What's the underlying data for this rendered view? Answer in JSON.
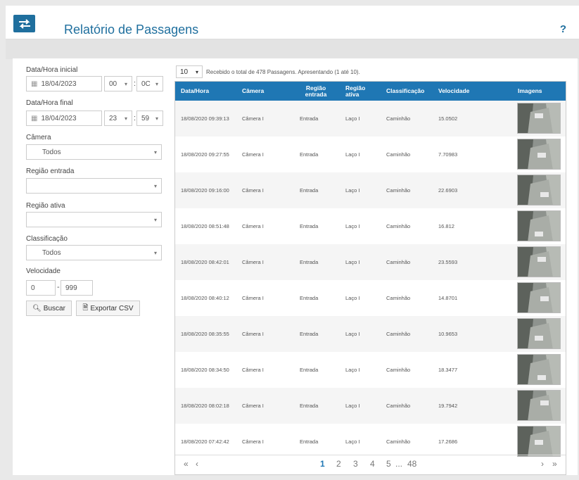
{
  "header": {
    "title": "Relatório de Passagens",
    "help": "?"
  },
  "filters": {
    "start_label": "Data/Hora inicial",
    "start_date": "18/04/2023",
    "start_hour": "00",
    "start_minute": "0C",
    "end_label": "Data/Hora final",
    "end_date": "18/04/2023",
    "end_hour": "23",
    "end_minute": "59",
    "camera_label": "Câmera",
    "camera_value": "Todos",
    "entry_region_label": "Região entrada",
    "entry_region_value": "",
    "active_region_label": "Região ativa",
    "active_region_value": "",
    "classification_label": "Classificação",
    "classification_value": "Todos",
    "speed_label": "Velocidade",
    "speed_min": "0",
    "speed_sep": "-",
    "speed_max": "999",
    "search_label": "Buscar",
    "export_label": "Exportar CSV"
  },
  "results": {
    "page_size": "10",
    "summary": "Recebido o total de 478 Passagens. Apresentando (1 até 10)."
  },
  "table": {
    "columns": [
      "Data/Hora",
      "Câmera",
      "Região entrada",
      "Região ativa",
      "Classificação",
      "Velocidade",
      "Imagens"
    ],
    "rows": [
      [
        "18/08/2020 09:39:13",
        "Câmera I",
        "Entrada",
        "Laço I",
        "Caminhão",
        "15.0502"
      ],
      [
        "18/08/2020 09:27:55",
        "Câmera I",
        "Entrada",
        "Laço I",
        "Caminhão",
        "7.70983"
      ],
      [
        "18/08/2020 09:16:00",
        "Câmera I",
        "Entrada",
        "Laço I",
        "Caminhão",
        "22.6903"
      ],
      [
        "18/08/2020 08:51:48",
        "Câmera I",
        "Entrada",
        "Laço I",
        "Caminhão",
        "16.812"
      ],
      [
        "18/08/2020 08:42:01",
        "Câmera I",
        "Entrada",
        "Laço I",
        "Caminhão",
        "23.5593"
      ],
      [
        "18/08/2020 08:40:12",
        "Câmera I",
        "Entrada",
        "Laço I",
        "Caminhão",
        "14.8701"
      ],
      [
        "18/08/2020 08:35:55",
        "Câmera I",
        "Entrada",
        "Laço I",
        "Caminhão",
        "10.9653"
      ],
      [
        "18/08/2020 08:34:50",
        "Câmera I",
        "Entrada",
        "Laço I",
        "Caminhão",
        "18.3477"
      ],
      [
        "18/08/2020 08:02:18",
        "Câmera I",
        "Entrada",
        "Laço I",
        "Caminhão",
        "19.7942"
      ],
      [
        "18/08/2020 07:42:42",
        "Câmera I",
        "Entrada",
        "Laço I",
        "Caminhão",
        "17.2686"
      ]
    ]
  },
  "pagination": {
    "first": "«",
    "prev": "‹",
    "pages": [
      "1",
      "2",
      "3",
      "4",
      "5"
    ],
    "ellipsis": "...",
    "last_page": "48",
    "next": "›",
    "last": "»"
  },
  "colors": {
    "accent": "#1f77b4",
    "header_title": "#1f6f9e"
  }
}
